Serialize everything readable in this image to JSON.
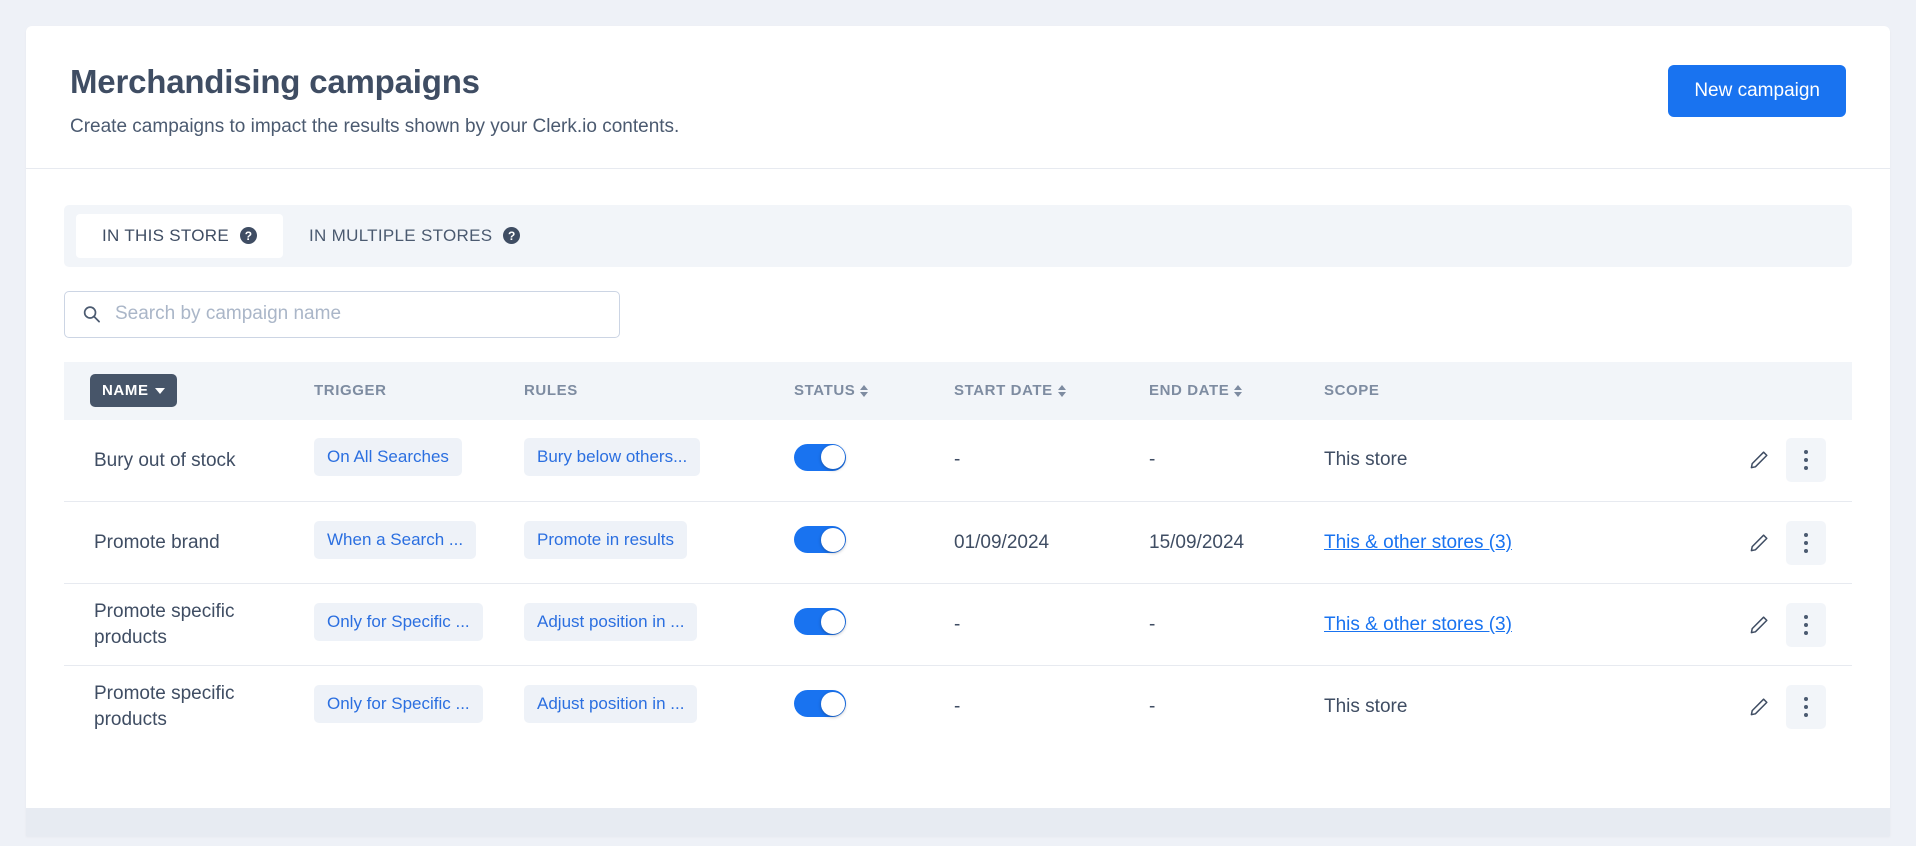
{
  "header": {
    "title": "Merchandising campaigns",
    "subtitle": "Create campaigns to impact the results shown by your Clerk.io contents.",
    "new_campaign_label": "New campaign",
    "accent_color": "#1973f0"
  },
  "tabs": [
    {
      "label": "IN THIS STORE",
      "help": "?",
      "active": true
    },
    {
      "label": "IN MULTIPLE STORES",
      "help": "?",
      "active": false
    }
  ],
  "search": {
    "placeholder": "Search by campaign name",
    "value": "",
    "icon": "search-icon"
  },
  "table": {
    "columns": [
      {
        "key": "name",
        "label": "NAME",
        "sort": "desc",
        "active": true
      },
      {
        "key": "trigger",
        "label": "TRIGGER",
        "sort": null,
        "active": false
      },
      {
        "key": "rules",
        "label": "RULES",
        "sort": null,
        "active": false
      },
      {
        "key": "status",
        "label": "STATUS",
        "sort": "both",
        "active": false
      },
      {
        "key": "start_date",
        "label": "START DATE",
        "sort": "both",
        "active": false
      },
      {
        "key": "end_date",
        "label": "END DATE",
        "sort": "both",
        "active": false
      },
      {
        "key": "scope",
        "label": "SCOPE",
        "sort": null,
        "active": false
      }
    ],
    "rows": [
      {
        "name": "Bury out of stock",
        "trigger": "On All Searches",
        "rules": "Bury below others...",
        "status_on": true,
        "start_date": "-",
        "end_date": "-",
        "scope": "This store",
        "scope_is_link": false
      },
      {
        "name": "Promote brand",
        "trigger": "When a Search ...",
        "rules": "Promote in results",
        "status_on": true,
        "start_date": "01/09/2024",
        "end_date": "15/09/2024",
        "scope": "This & other stores (3)",
        "scope_is_link": true
      },
      {
        "name": "Promote specific products",
        "trigger": "Only for Specific ...",
        "rules": "Adjust position in ...",
        "status_on": true,
        "start_date": "-",
        "end_date": "-",
        "scope": "This & other stores (3)",
        "scope_is_link": true
      },
      {
        "name": "Promote specific products",
        "trigger": "Only for Specific ...",
        "rules": "Adjust position in ...",
        "status_on": true,
        "start_date": "-",
        "end_date": "-",
        "scope": "This store",
        "scope_is_link": false
      }
    ],
    "row_actions": {
      "edit_icon": "pencil-icon",
      "menu_icon": "kebab-menu-icon"
    }
  }
}
